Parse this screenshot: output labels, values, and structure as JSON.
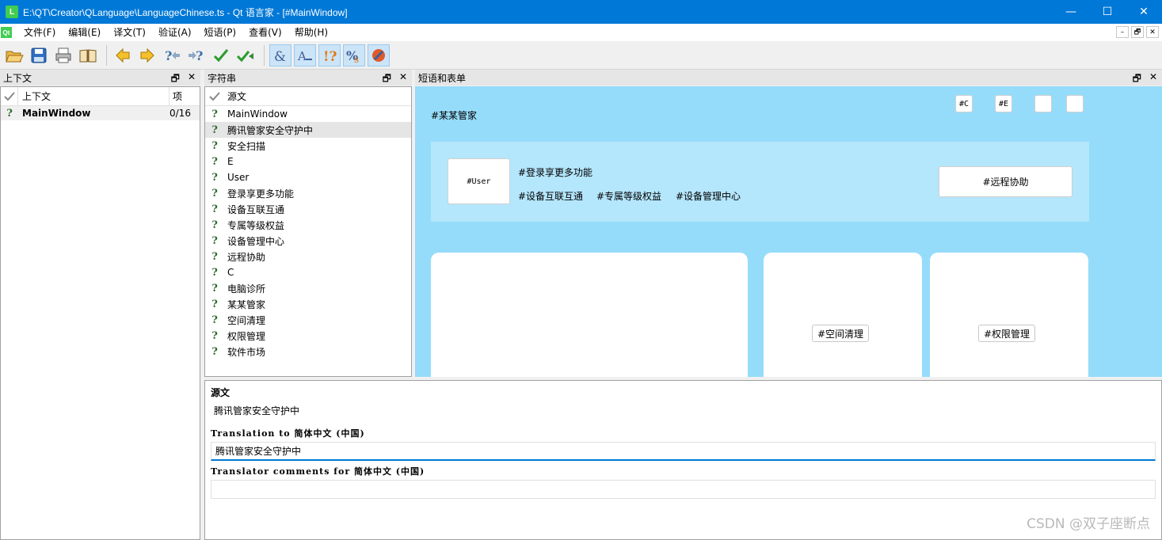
{
  "window": {
    "title": "E:\\QT\\Creator\\QLanguage\\LanguageChinese.ts - Qt 语言家 - [#MainWindow]",
    "app_icon": "L",
    "controls": {
      "minimize": "—",
      "maximize": "☐",
      "close": "✕"
    }
  },
  "menubar": {
    "logo": "Qt",
    "items": [
      "文件(F)",
      "编辑(E)",
      "译文(T)",
      "验证(A)",
      "短语(P)",
      "查看(V)",
      "帮助(H)"
    ],
    "mdi": {
      "minimize": "–",
      "restore": "🗗",
      "close": "✕"
    }
  },
  "toolbar": {
    "icons": [
      "open-folder-icon",
      "save-icon",
      "print-icon",
      "phrase-book-icon",
      "prev-arrow-icon",
      "next-arrow-icon",
      "prev-unfinished-icon",
      "next-unfinished-icon",
      "done-check-icon",
      "done-next-icon",
      "accelerator-icon",
      "punctuation-icon",
      "phrase-match-icon",
      "placeholder-icon",
      "surrounding-whitespace-icon"
    ]
  },
  "context_panel": {
    "title": "上下文",
    "header": {
      "label": "上下文",
      "count": "项"
    },
    "rows": [
      {
        "name": "MainWindow",
        "count": "0/16"
      }
    ]
  },
  "strings_panel": {
    "title": "字符串",
    "header": "源文",
    "items": [
      "MainWindow",
      "腾讯管家安全守护中",
      "安全扫描",
      "E",
      "User",
      "登录享更多功能",
      "设备互联互通",
      "专属等级权益",
      "设备管理中心",
      "远程协助",
      "C",
      "电脑诊所",
      "某某管家",
      "空间清理",
      "权限管理",
      "软件市场"
    ],
    "selected_index": 1
  },
  "form_panel": {
    "title": "短语和表单",
    "brand": "#某某管家",
    "top_buttons": [
      "#C",
      "#E",
      "",
      ""
    ],
    "user_avatar": "#User",
    "user_login": "#登录享更多功能",
    "features": [
      "#设备互联互通",
      "#专属等级权益",
      "#设备管理中心"
    ],
    "remote_button": "#远程协助",
    "card_buttons": [
      "#空间清理",
      "#权限管理"
    ]
  },
  "editor": {
    "source_title": "源文",
    "source_text": "腾讯管家安全守护中",
    "translation_label": "Translation to 简体中文 (中国)",
    "translation_value": "腾讯管家安全守护中",
    "comments_label": "Translator comments for 简体中文 (中国)",
    "comments_value": ""
  },
  "watermark": "CSDN @双子座断点",
  "colors": {
    "titlebar": "#0078d7",
    "form_bg": "#95dcfa",
    "user_bar": "#b4e6fc",
    "qt_green": "#41cd52"
  }
}
